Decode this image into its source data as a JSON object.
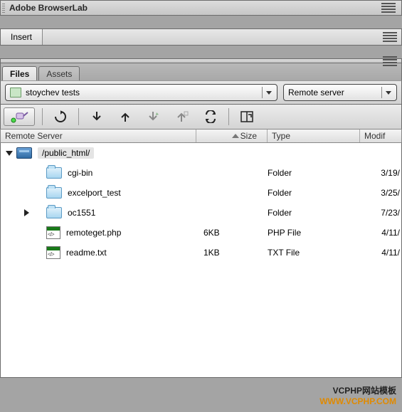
{
  "panel_browserlab_title": "Adobe BrowserLab",
  "insert_label": "Insert",
  "tabs": {
    "files": "Files",
    "assets": "Assets"
  },
  "project_dropdown": "stoychev tests",
  "server_dropdown": "Remote server",
  "columns": {
    "name": "Remote Server",
    "size": "Size",
    "type": "Type",
    "modified": "Modif"
  },
  "root": {
    "path": "/public_html/"
  },
  "rows": [
    {
      "name": "cgi-bin",
      "size": "",
      "type": "Folder",
      "modified": "3/19/",
      "kind": "folder",
      "expand": "none"
    },
    {
      "name": "excelport_test",
      "size": "",
      "type": "Folder",
      "modified": "3/25/",
      "kind": "folder",
      "expand": "none"
    },
    {
      "name": "oc1551",
      "size": "",
      "type": "Folder",
      "modified": "7/23/",
      "kind": "folder",
      "expand": "right"
    },
    {
      "name": "remoteget.php",
      "size": "6KB",
      "type": "PHP File",
      "modified": "4/11/",
      "kind": "file",
      "expand": "none"
    },
    {
      "name": "readme.txt",
      "size": "1KB",
      "type": "TXT File",
      "modified": "4/11/",
      "kind": "file",
      "expand": "none"
    }
  ],
  "watermark": {
    "line1": "VCPHP网站模板",
    "line2": "WWW.VCPHP.COM"
  }
}
